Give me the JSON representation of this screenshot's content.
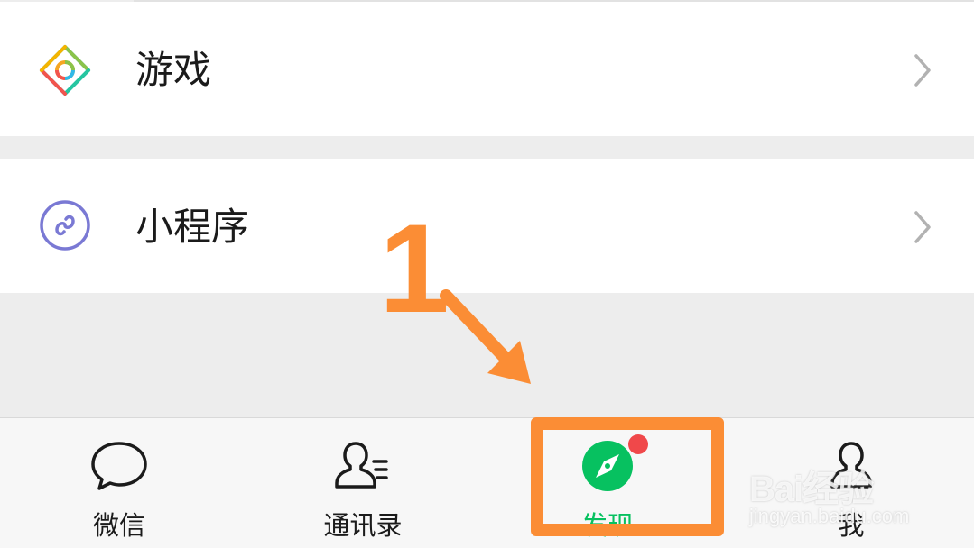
{
  "discover_list": {
    "games_label": "游戏",
    "mini_programs_label": "小程序"
  },
  "tabbar": {
    "chats_label": "微信",
    "contacts_label": "通讯录",
    "discover_label": "发现",
    "me_label": "我",
    "active_tab": "发现",
    "active_color": "#07c160"
  },
  "annotation": {
    "step_number": "1",
    "color": "#fb8d35"
  },
  "watermark": {
    "brand": "Bai经验",
    "url": "jingyan.baidu.com"
  },
  "icons": {
    "games": "games-icon",
    "mini_programs": "mini-programs-icon",
    "chevron": "chevron-right-icon",
    "chats": "chat-bubble-icon",
    "contacts": "contacts-icon",
    "discover": "compass-icon",
    "me": "person-icon"
  },
  "colors": {
    "background": "#ededed",
    "badge": "#f0484a",
    "mini_programs_icon": "#7a79d4"
  }
}
